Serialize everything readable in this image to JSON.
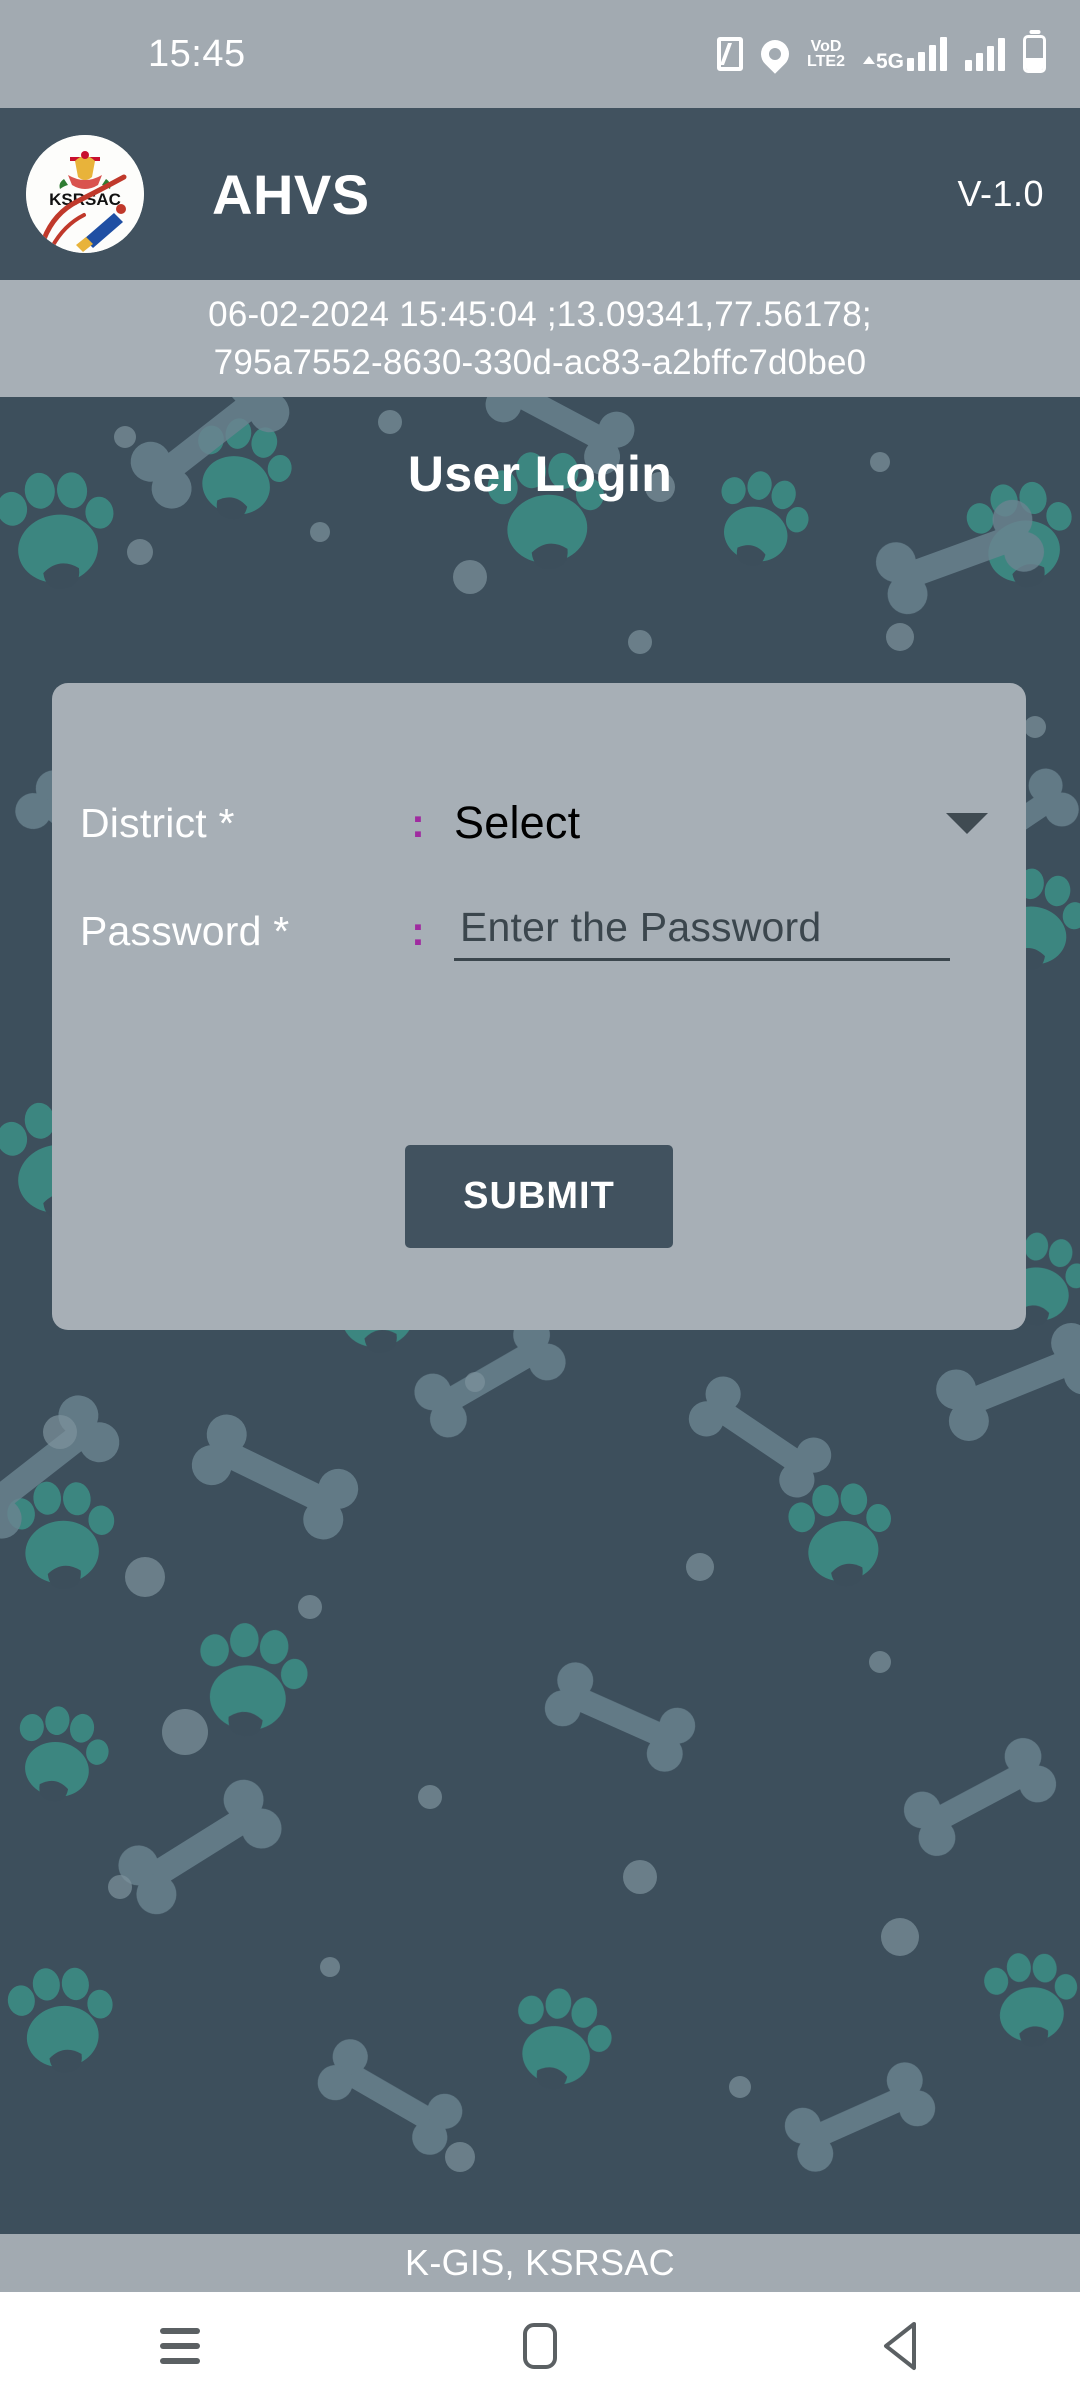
{
  "status_bar": {
    "time": "15:45",
    "icons": [
      "nfc-icon",
      "location-pin-icon",
      "volte-icon",
      "5g-icon",
      "signal-bars-icon",
      "battery-icon"
    ],
    "volte_line1": "VoD",
    "volte_line2": "LTE2",
    "network_label": "5G",
    "background": "#a2aab1"
  },
  "app_bar": {
    "logo_text": "KSRSAC",
    "title": "AHVS",
    "version": "V-1.0",
    "background": "#41525f"
  },
  "info_strip": {
    "line1": "06-02-2024 15:45:04 ;13.09341,77.56178;",
    "line2": "795a7552-8630-330d-ac83-a2bffc7d0be0",
    "background": "#a7afb6"
  },
  "main": {
    "page_title": "User Login",
    "background": "#3d4f5c",
    "pattern": {
      "paw_color": "#3d8c84",
      "bone_color": "#6b8490",
      "dot_color": "#7d939d"
    },
    "card": {
      "background": "#a7afb6",
      "fields": [
        {
          "label": "District *",
          "colon": ":",
          "type": "select",
          "value": "Select",
          "caret": "chevron-down-icon"
        },
        {
          "label": "Password *",
          "colon": ":",
          "type": "password",
          "value": "",
          "placeholder": "Enter the Password"
        }
      ],
      "submit_label": "SUBMIT",
      "colon_color": "#a02ba0",
      "label_color": "#ffffff",
      "value_color": "#000000"
    }
  },
  "footer": {
    "text": "K-GIS, KSRSAC",
    "background": "#a2aab1"
  },
  "nav_bar": {
    "recents": "recents-icon",
    "home": "home-icon",
    "back": "back-icon",
    "background": "#ffffff"
  }
}
